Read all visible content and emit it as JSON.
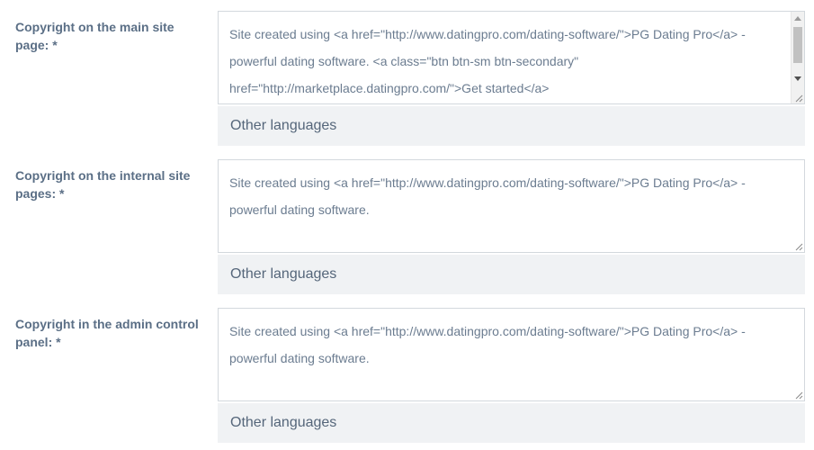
{
  "fields": [
    {
      "label": "Copyright on the main site page: *",
      "value": "Site created using <a href=\"http://www.datingpro.com/dating-software/\">PG Dating Pro</a> - powerful dating software. <a class=\"btn btn-sm btn-secondary\" href=\"http://marketplace.datingpro.com/\">Get started</a>",
      "other_languages": "Other languages"
    },
    {
      "label": "Copyright on the internal site pages: *",
      "value": "Site created using <a href=\"http://www.datingpro.com/dating-software/\">PG Dating Pro</a> - powerful dating software.",
      "other_languages": "Other languages"
    },
    {
      "label": "Copyright in the admin control panel: *",
      "value": "Site created using <a href=\"http://www.datingpro.com/dating-software/\">PG Dating Pro</a> - powerful dating software.",
      "other_languages": "Other languages"
    }
  ]
}
